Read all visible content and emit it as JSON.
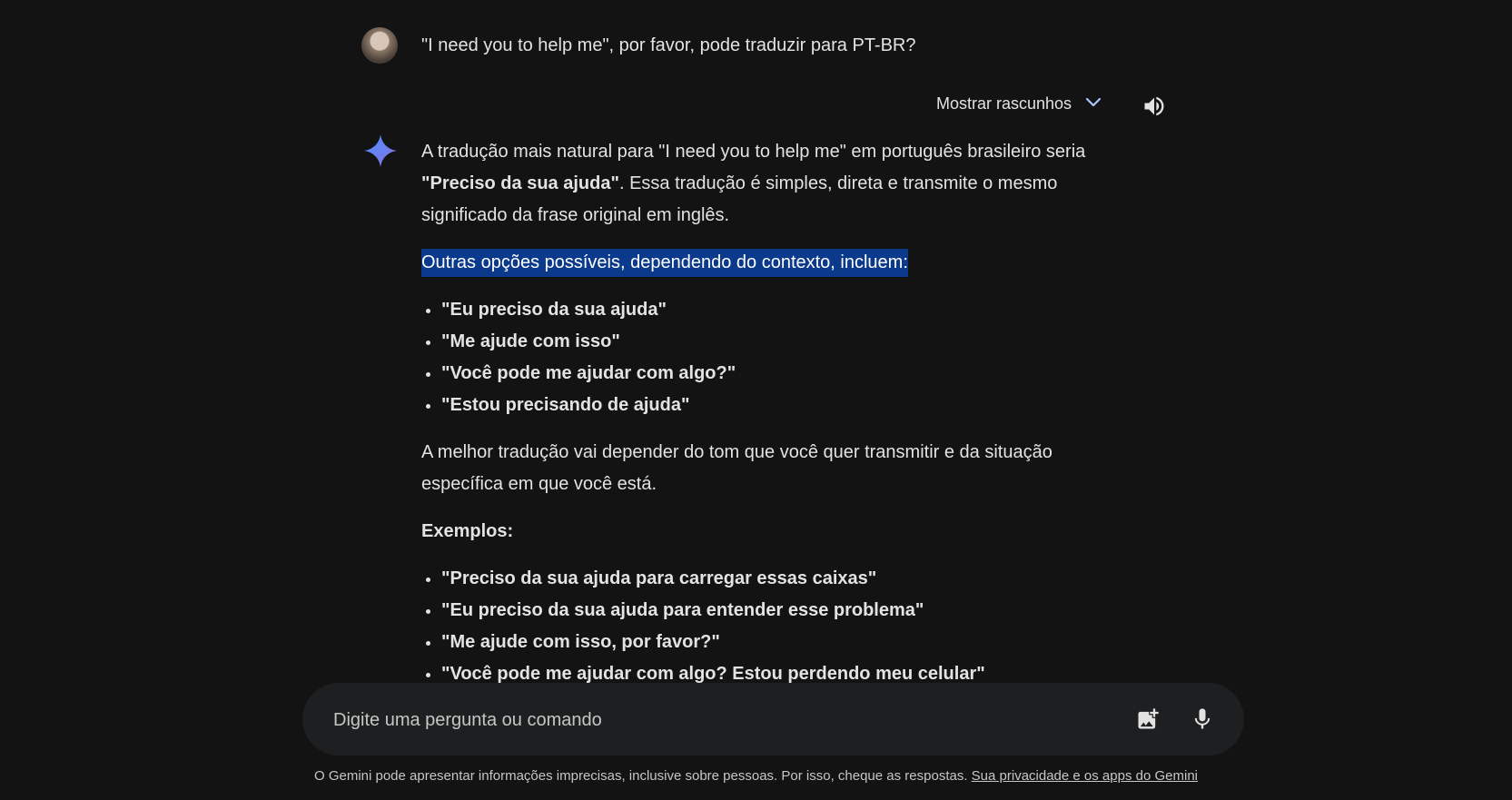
{
  "user": {
    "prompt": "\"I need you to help me\", por favor, pode traduzir para PT-BR?"
  },
  "drafts": {
    "label": "Mostrar rascunhos"
  },
  "answer": {
    "p1_text_a": "A tradução mais natural para \"I need you to help me\" em português brasileiro seria ",
    "p1_bold": "\"Preciso da sua ajuda\"",
    "p1_text_b": ". Essa tradução é simples, direta e transmite o mesmo significado da frase original em inglês.",
    "p2": "Outras opções possíveis, dependendo do contexto, incluem:",
    "options": [
      "\"Eu preciso da sua ajuda\"",
      "\"Me ajude com isso\"",
      "\"Você pode me ajudar com algo?\"",
      "\"Estou precisando de ajuda\""
    ],
    "p3": "A melhor tradução vai depender do tom que você quer transmitir e da situação específica em que você está.",
    "examples_title": "Exemplos:",
    "examples": [
      "\"Preciso da sua ajuda para carregar essas caixas\"",
      "\"Eu preciso da sua ajuda para entender esse problema\"",
      "\"Me ajude com isso, por favor?\"",
      "\"Você pode me ajudar com algo? Estou perdendo meu celular\""
    ]
  },
  "input": {
    "placeholder": "Digite uma pergunta ou comando"
  },
  "footer": {
    "text": "O Gemini pode apresentar informações imprecisas, inclusive sobre pessoas. Por isso, cheque as respostas. ",
    "link": "Sua privacidade e os apps do Gemini"
  },
  "icons": {
    "avatar": "user-avatar",
    "chevron": "chevron-down-icon",
    "speaker": "speaker-icon",
    "spark": "gemini-spark-icon",
    "image": "add-image-icon",
    "mic": "mic-icon"
  },
  "colors": {
    "background": "#131314",
    "input_background": "#1e1f20",
    "highlight": "#0b3a8c",
    "accent": "#a8c7fa"
  }
}
